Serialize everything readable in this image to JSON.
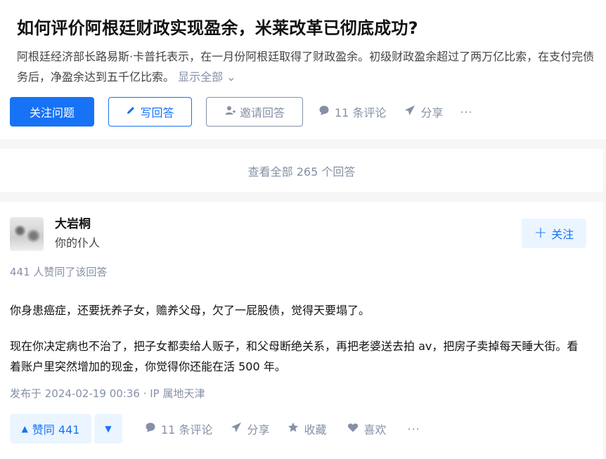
{
  "question": {
    "title": "如何评价阿根廷财政实现盈余，米莱改革已彻底成功?",
    "detail": "阿根廷经济部长路易斯·卡普托表示，在一月份阿根廷取得了财政盈余。初级财政盈余超过了两万亿比索，在支付完债务后，净盈余达到五千亿比索。",
    "show_all": "显示全部 ⌄",
    "actions": {
      "follow": "关注问题",
      "write": "写回答",
      "invite": "邀请回答",
      "comments": "11 条评论",
      "share": "分享",
      "more": "···"
    }
  },
  "view_all_answers": "查看全部 265 个回答",
  "answer": {
    "author_name": "大岩桐",
    "author_bio": "你的仆人",
    "follow": "关注",
    "votes_info": "441 人赞同了该回答",
    "paragraphs": [
      "你身患癌症，还要抚养子女，赡养父母，欠了一屁股债，觉得天要塌了。",
      "现在你决定病也不治了，把子女都卖给人贩子，和父母断绝关系，再把老婆送去拍 av，把房子卖掉每天睡大街。看着账户里突然增加的现金，你觉得你还能在活 500 年。"
    ],
    "meta": "发布于 2024-02-19 00:36 · IP 属地天津",
    "actions": {
      "upvote": "赞同 441",
      "comments": "11 条评论",
      "share": "分享",
      "collect": "收藏",
      "like": "喜欢",
      "more": "···"
    }
  },
  "icons": {
    "pen": "pen-icon",
    "invite": "add-user-icon",
    "comment": "comment-bubble-icon",
    "share": "paper-plane-icon",
    "plus": "plus-icon",
    "upvote": "triangle-up-icon",
    "downvote": "triangle-down-icon",
    "star": "star-icon",
    "heart": "heart-icon"
  },
  "colors": {
    "accent": "#1772f6",
    "muted": "#8590a6",
    "accent_light_bg": "#ebf5ff"
  }
}
